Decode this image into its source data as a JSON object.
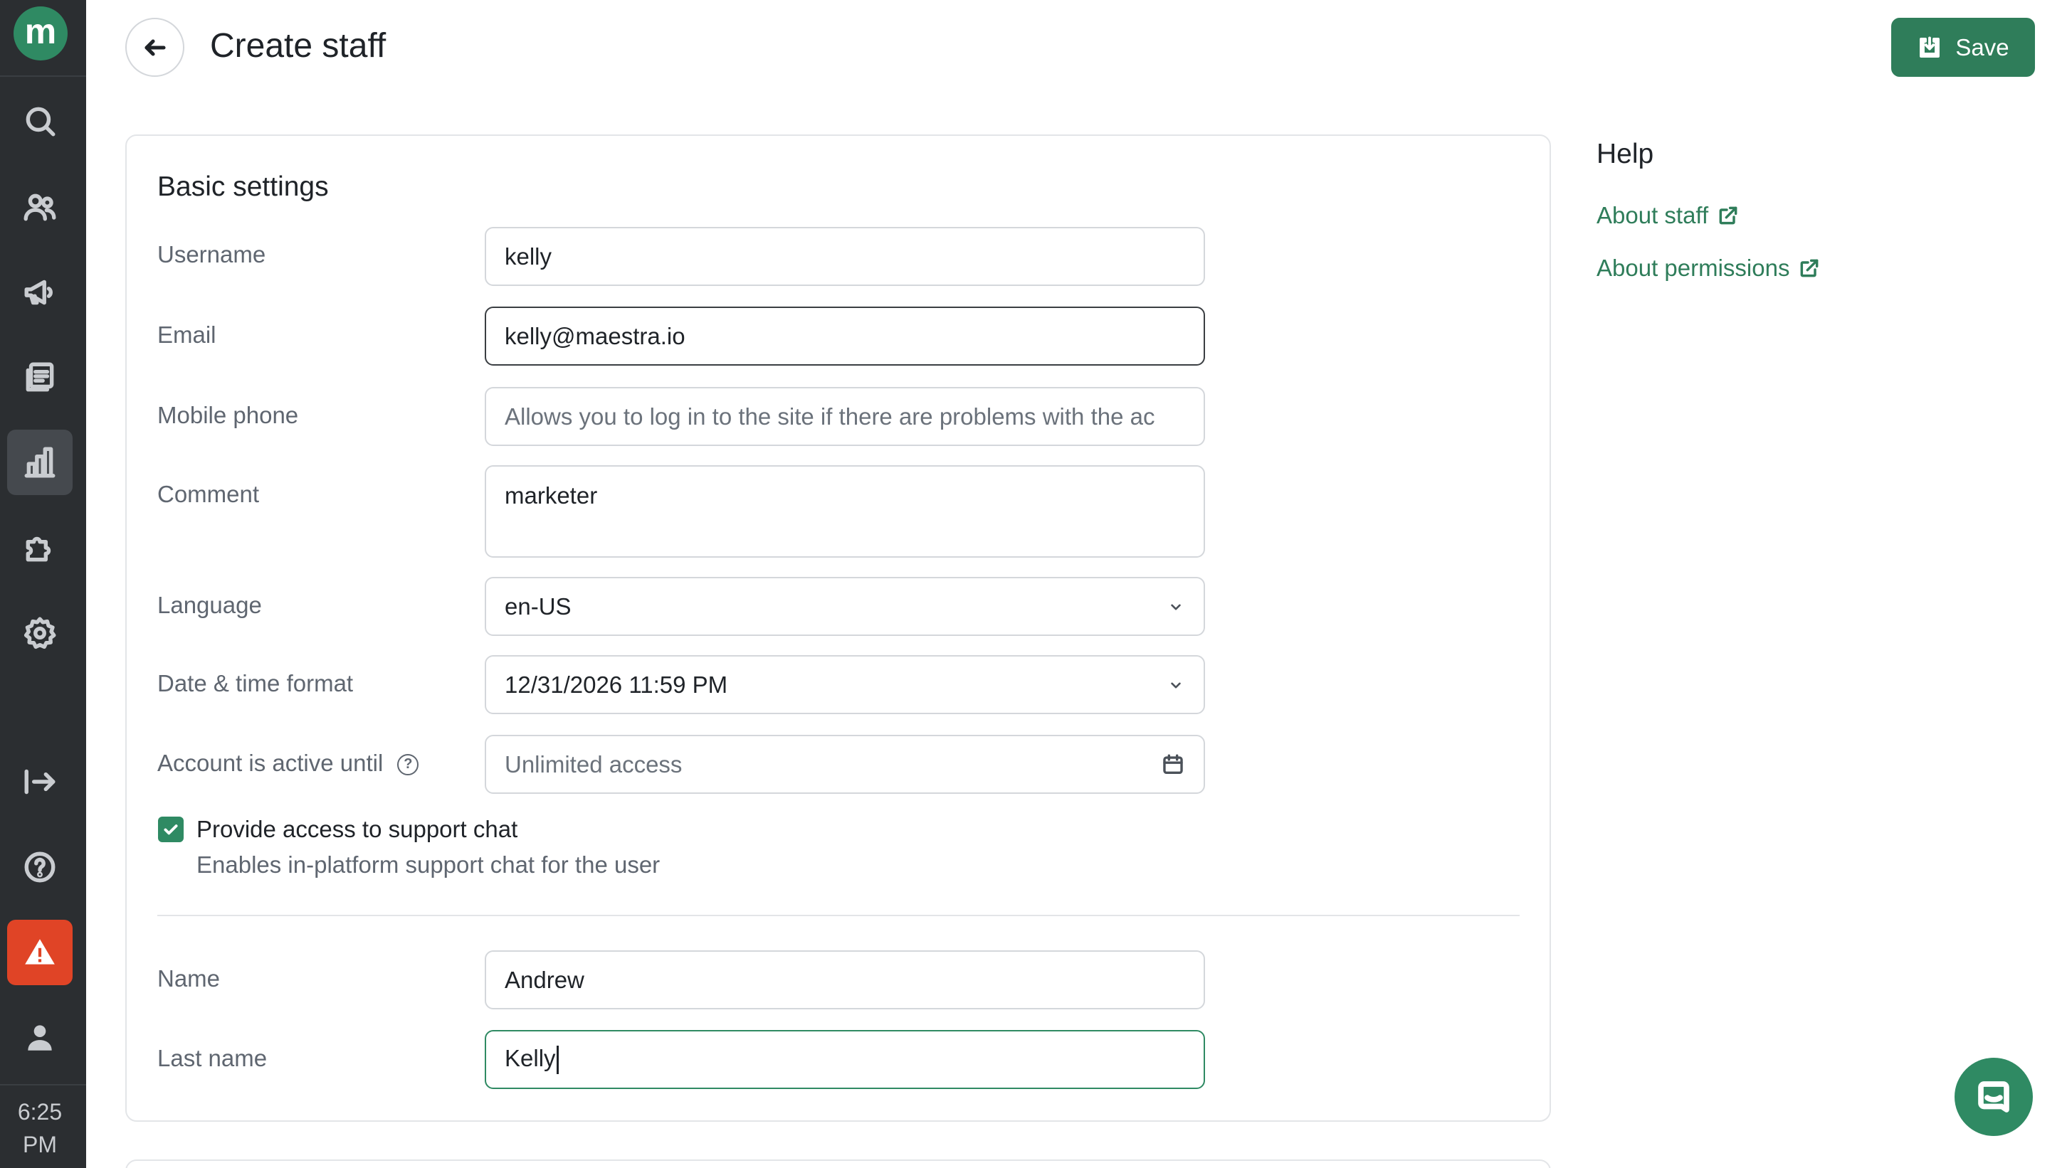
{
  "app": {
    "logo_letter": "m",
    "time": "6:25 PM"
  },
  "sidebar": {
    "items": [
      {
        "icon": "search-icon"
      },
      {
        "icon": "users-icon"
      },
      {
        "icon": "megaphone-icon"
      },
      {
        "icon": "documents-icon"
      },
      {
        "icon": "analytics-icon",
        "active": true
      },
      {
        "icon": "puzzle-icon"
      },
      {
        "icon": "gear-icon"
      },
      {
        "icon": "logout-icon"
      },
      {
        "icon": "help-icon"
      },
      {
        "icon": "warning-icon",
        "alert": true
      },
      {
        "icon": "user-icon"
      }
    ],
    "time_line1": "6:25",
    "time_line2": "PM"
  },
  "header": {
    "title": "Create staff",
    "save_label": "Save"
  },
  "form": {
    "section_title": "Basic settings",
    "username": {
      "label": "Username",
      "value": "kelly"
    },
    "email": {
      "label": "Email",
      "value": "kelly@maestra.io"
    },
    "mobile_phone": {
      "label": "Mobile phone",
      "placeholder": "Allows you to log in to the site if there are problems with the ac"
    },
    "comment": {
      "label": "Comment",
      "value": "marketer"
    },
    "language": {
      "label": "Language",
      "value": "en-US"
    },
    "date_time_format": {
      "label": "Date & time format",
      "value": "12/31/2026 11:59 PM"
    },
    "account_active_until": {
      "label": "Account is active until",
      "placeholder": "Unlimited access",
      "help_glyph": "?"
    },
    "support_chat": {
      "checked": true,
      "label": "Provide access to support chat",
      "description": "Enables in-platform support chat for the user"
    },
    "name": {
      "label": "Name",
      "value": "Andrew"
    },
    "last_name": {
      "label": "Last name",
      "value": "Kelly"
    }
  },
  "help": {
    "title": "Help",
    "links": [
      {
        "label": "About staff"
      },
      {
        "label": "About permissions"
      }
    ]
  },
  "colors": {
    "accent": "#2f7d5a",
    "sidebar_bg": "#2b2e31",
    "alert": "#e04426"
  }
}
